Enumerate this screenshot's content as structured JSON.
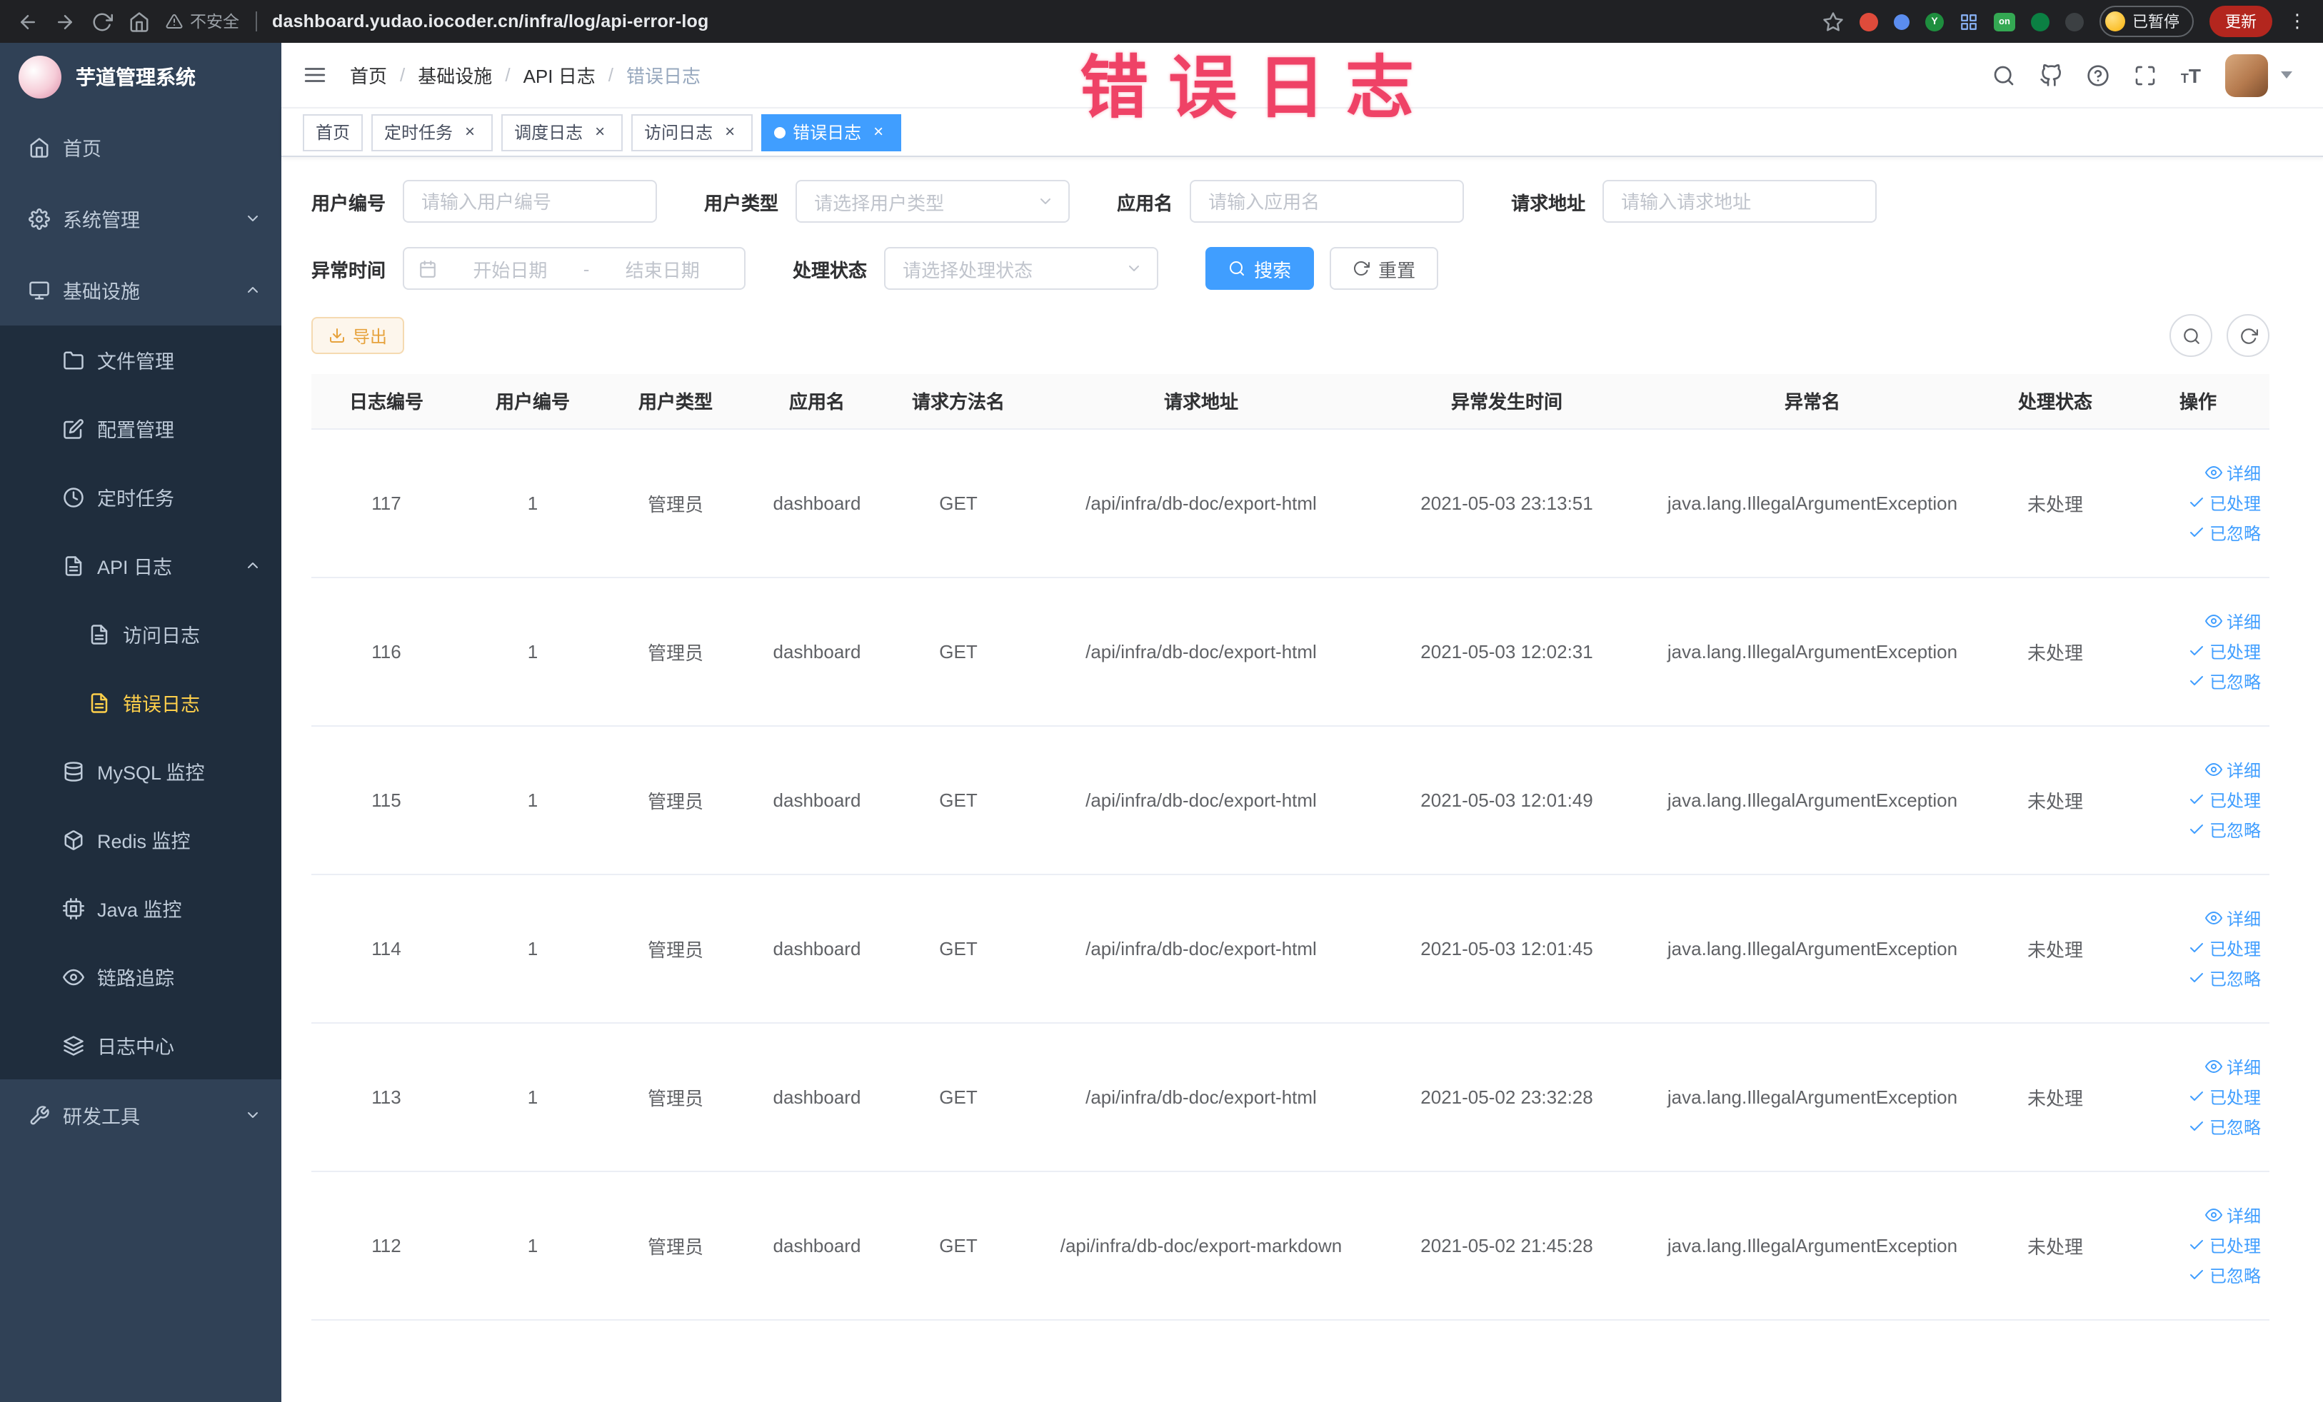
{
  "colors": {
    "accent": "#409eff",
    "chrome_bg": "#202124",
    "sidebar_bg": "#304156",
    "submenu_bg": "#1f2d3d",
    "menu_text": "#bfcbd9",
    "menu_active_text": "#ffd04b",
    "watermark": "#ef4266",
    "export_text": "#e6a23c",
    "export_bg": "#fdf6ec",
    "export_border": "#f5dab1",
    "update_button": "#b3261e"
  },
  "browser": {
    "security_label": "不安全",
    "url": "dashboard.yudao.iocoder.cn/infra/log/api-error-log",
    "paused_label": "已暂停",
    "update_label": "更新"
  },
  "sidebar": {
    "title": "芋道管理系统",
    "menu": [
      {
        "name": "home",
        "icon": "home",
        "label": "首页"
      },
      {
        "name": "system",
        "icon": "gear",
        "label": "系统管理",
        "state": "collapsed",
        "children": []
      },
      {
        "name": "infrastructure",
        "icon": "monitor",
        "label": "基础设施",
        "state": "expanded",
        "children": [
          {
            "name": "file",
            "icon": "folder",
            "label": "文件管理"
          },
          {
            "name": "config",
            "icon": "edit",
            "label": "配置管理"
          },
          {
            "name": "job",
            "icon": "clock",
            "label": "定时任务"
          },
          {
            "name": "api-log",
            "icon": "file",
            "label": "API 日志",
            "state": "expanded",
            "children": [
              {
                "name": "access-log",
                "icon": "file",
                "label": "访问日志"
              },
              {
                "name": "error-log",
                "icon": "file",
                "label": "错误日志",
                "active": true
              }
            ]
          },
          {
            "name": "mysql",
            "icon": "database",
            "label": "MySQL 监控"
          },
          {
            "name": "redis",
            "icon": "box",
            "label": "Redis 监控"
          },
          {
            "name": "java",
            "icon": "cpu",
            "label": "Java 监控"
          },
          {
            "name": "trace",
            "icon": "eye",
            "label": "链路追踪"
          },
          {
            "name": "log-center",
            "icon": "layers",
            "label": "日志中心"
          }
        ]
      },
      {
        "name": "devtools",
        "icon": "tool",
        "label": "研发工具",
        "state": "collapsed",
        "children": []
      }
    ]
  },
  "header": {
    "breadcrumb": [
      "首页",
      "基础设施",
      "API 日志",
      "错误日志"
    ],
    "watermark": "错误日志"
  },
  "tabs": [
    {
      "name": "home",
      "label": "首页",
      "closable": false,
      "active": false
    },
    {
      "name": "scheduled-job",
      "label": "定时任务",
      "closable": true,
      "active": false
    },
    {
      "name": "job-log",
      "label": "调度日志",
      "closable": true,
      "active": false
    },
    {
      "name": "access-log",
      "label": "访问日志",
      "closable": true,
      "active": false
    },
    {
      "name": "error-log",
      "label": "错误日志",
      "closable": true,
      "active": true
    }
  ],
  "filters": {
    "user_id": {
      "label": "用户编号",
      "placeholder": "请输入用户编号"
    },
    "user_type": {
      "label": "用户类型",
      "placeholder": "请选择用户类型"
    },
    "app_name": {
      "label": "应用名",
      "placeholder": "请输入应用名"
    },
    "request_url": {
      "label": "请求地址",
      "placeholder": "请输入请求地址"
    },
    "exception_time": {
      "label": "异常时间",
      "start_placeholder": "开始日期",
      "separator": "-",
      "end_placeholder": "结束日期"
    },
    "process_status": {
      "label": "处理状态",
      "placeholder": "请选择处理状态"
    },
    "search_label": "搜索",
    "reset_label": "重置"
  },
  "toolbar": {
    "export_label": "导出"
  },
  "table": {
    "columns": [
      {
        "key": "id",
        "label": "日志编号"
      },
      {
        "key": "user_id",
        "label": "用户编号"
      },
      {
        "key": "user_type",
        "label": "用户类型"
      },
      {
        "key": "app",
        "label": "应用名"
      },
      {
        "key": "method",
        "label": "请求方法名"
      },
      {
        "key": "url",
        "label": "请求地址"
      },
      {
        "key": "time",
        "label": "异常发生时间"
      },
      {
        "key": "exception",
        "label": "异常名"
      },
      {
        "key": "status",
        "label": "处理状态"
      },
      {
        "key": "actions",
        "label": "操作"
      }
    ],
    "actions": [
      {
        "name": "detail",
        "icon": "eye",
        "label": "详细"
      },
      {
        "name": "processed",
        "icon": "check",
        "label": "已处理"
      },
      {
        "name": "ignored",
        "icon": "check",
        "label": "已忽略"
      }
    ],
    "rows": [
      {
        "id": "117",
        "user_id": "1",
        "user_type": "管理员",
        "app": "dashboard",
        "method": "GET",
        "url": "/api/infra/db-doc/export-html",
        "time": "2021-05-03 23:13:51",
        "exception": "java.lang.IllegalArgumentException",
        "status": "未处理"
      },
      {
        "id": "116",
        "user_id": "1",
        "user_type": "管理员",
        "app": "dashboard",
        "method": "GET",
        "url": "/api/infra/db-doc/export-html",
        "time": "2021-05-03 12:02:31",
        "exception": "java.lang.IllegalArgumentException",
        "status": "未处理"
      },
      {
        "id": "115",
        "user_id": "1",
        "user_type": "管理员",
        "app": "dashboard",
        "method": "GET",
        "url": "/api/infra/db-doc/export-html",
        "time": "2021-05-03 12:01:49",
        "exception": "java.lang.IllegalArgumentException",
        "status": "未处理"
      },
      {
        "id": "114",
        "user_id": "1",
        "user_type": "管理员",
        "app": "dashboard",
        "method": "GET",
        "url": "/api/infra/db-doc/export-html",
        "time": "2021-05-03 12:01:45",
        "exception": "java.lang.IllegalArgumentException",
        "status": "未处理"
      },
      {
        "id": "113",
        "user_id": "1",
        "user_type": "管理员",
        "app": "dashboard",
        "method": "GET",
        "url": "/api/infra/db-doc/export-html",
        "time": "2021-05-02 23:32:28",
        "exception": "java.lang.IllegalArgumentException",
        "status": "未处理"
      },
      {
        "id": "112",
        "user_id": "1",
        "user_type": "管理员",
        "app": "dashboard",
        "method": "GET",
        "url": "/api/infra/db-doc/export-markdown",
        "time": "2021-05-02 21:45:28",
        "exception": "java.lang.IllegalArgumentException",
        "status": "未处理"
      }
    ]
  }
}
